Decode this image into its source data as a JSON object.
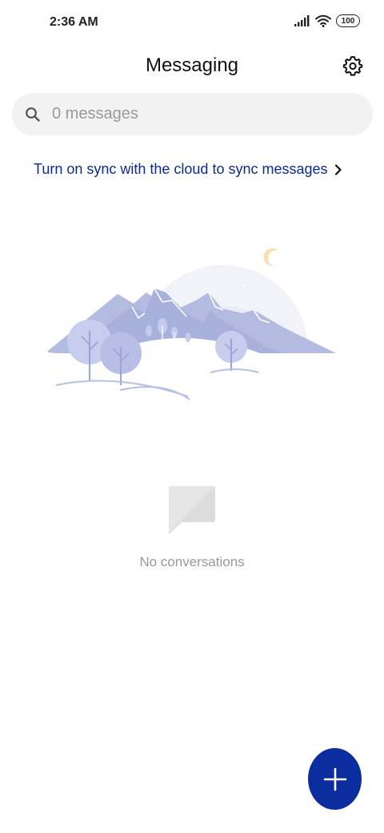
{
  "status_bar": {
    "time": "2:36 AM",
    "battery": "100",
    "icons": [
      "signal-icon",
      "wifi-icon",
      "battery-icon"
    ]
  },
  "header": {
    "title": "Messaging",
    "settings_icon": "gear-icon"
  },
  "search": {
    "placeholder": "0 messages",
    "icon": "search-icon"
  },
  "sync_banner": {
    "text": "Turn on sync with the cloud to sync messages",
    "icon": "chevron-right-icon"
  },
  "empty_state": {
    "text": "No conversations",
    "icon": "message-bubble-icon"
  },
  "fab": {
    "icon": "plus-icon"
  },
  "colors": {
    "accent": "#0b2d9e",
    "link": "#0d2b8e",
    "search_bg": "#f2f2f2",
    "muted_text": "#999999"
  }
}
